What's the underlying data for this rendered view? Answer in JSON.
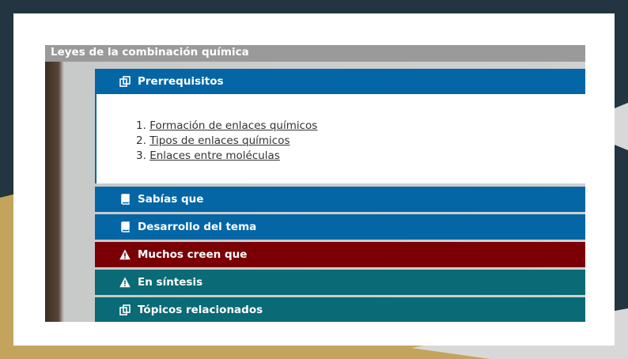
{
  "colors": {
    "background_dark": "#223540",
    "background_gold": "#c4a45d",
    "frame": "#ffffff",
    "title_bar": "#9a9a9a",
    "blue_section": "#0566a6",
    "red_section": "#7a0006",
    "teal_section": "#0a6a76"
  },
  "page": {
    "title": "Leyes de la combinación química"
  },
  "sections": [
    {
      "label": "Prerrequisitos",
      "icon": "copy-icon",
      "color": "blue",
      "expanded": true,
      "items": [
        {
          "number": "1.",
          "text": "Formación de enlaces químicos"
        },
        {
          "number": "2.",
          "text": "Tipos de enlaces químicos"
        },
        {
          "number": "3.",
          "text": "Enlaces entre moléculas"
        }
      ]
    },
    {
      "label": "Sabías que",
      "icon": "book-icon",
      "color": "blue",
      "expanded": false
    },
    {
      "label": "Desarrollo del tema",
      "icon": "book-icon",
      "color": "blue",
      "expanded": false
    },
    {
      "label": "Muchos creen que",
      "icon": "warning-icon",
      "color": "red",
      "expanded": false
    },
    {
      "label": "En síntesis",
      "icon": "warning-icon",
      "color": "teal",
      "expanded": false
    },
    {
      "label": "Tópicos relacionados",
      "icon": "copy-icon",
      "color": "teal",
      "expanded": false
    }
  ]
}
